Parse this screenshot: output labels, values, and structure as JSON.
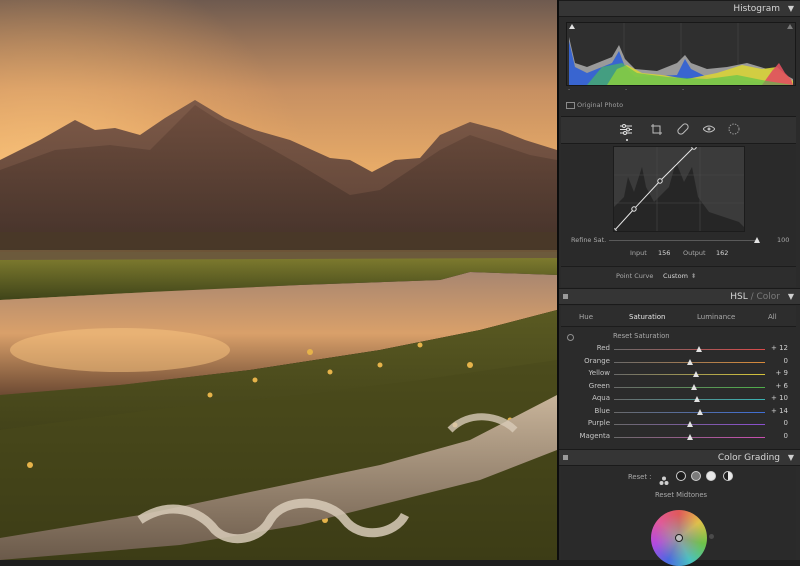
{
  "histogram": {
    "title": "Histogram",
    "original_photo_label": "Original Photo",
    "ticks": [
      "-",
      "-",
      "-",
      "-"
    ]
  },
  "toolbar": {
    "icons": [
      "sliders-icon",
      "crop-icon",
      "heal-icon",
      "masking-icon",
      "redeye-icon"
    ]
  },
  "curve": {
    "refine_label": "Refine Sat.",
    "refine_value": "100",
    "input_label": "Input",
    "input_value": "156",
    "output_label": "Output",
    "output_value": "162",
    "point_curve_label": "Point Curve",
    "point_curve_value": "Custom"
  },
  "hsl": {
    "title_main": "HSL",
    "title_sep": " / ",
    "title_alt": "Color",
    "tabs": [
      "Hue",
      "Saturation",
      "Luminance",
      "All"
    ],
    "active_tab": "Saturation",
    "reset_label": "Reset Saturation",
    "sliders": [
      {
        "name": "Red",
        "value": "+ 12",
        "level": 12,
        "color": "#d94a4a"
      },
      {
        "name": "Orange",
        "value": "0",
        "level": 0,
        "color": "#d98a3a"
      },
      {
        "name": "Yellow",
        "value": "+ 9",
        "level": 9,
        "color": "#d6c43a"
      },
      {
        "name": "Green",
        "value": "+ 6",
        "level": 6,
        "color": "#4fae4a"
      },
      {
        "name": "Aqua",
        "value": "+ 10",
        "level": 10,
        "color": "#3ab3b3"
      },
      {
        "name": "Blue",
        "value": "+ 14",
        "level": 14,
        "color": "#3f6fd6"
      },
      {
        "name": "Purple",
        "value": "0",
        "level": 0,
        "color": "#8b4fd0"
      },
      {
        "name": "Magenta",
        "value": "0",
        "level": 0,
        "color": "#c94fb0"
      }
    ]
  },
  "color_grading": {
    "title": "Color Grading",
    "reset_label": "Reset :",
    "reset_midtones_label": "Reset Midtones"
  }
}
